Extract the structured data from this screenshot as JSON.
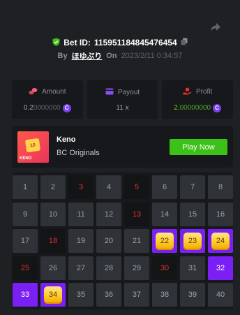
{
  "bet": {
    "id_label": "Bet ID:",
    "id_value": "115951184845476454",
    "by_label": "By",
    "user": "ほゆぷり",
    "on_label": "On",
    "timestamp": "2023/2/11 0:34:57"
  },
  "stats": {
    "amount": {
      "label": "Amount",
      "value_main": "0.2",
      "value_fade": "0000000",
      "coin": "C"
    },
    "payout": {
      "label": "Payout",
      "value": "11 x"
    },
    "profit": {
      "label": "Profit",
      "value_main": "2.",
      "value_fade": "00000000",
      "coin": "C"
    }
  },
  "game": {
    "name": "Keno",
    "provider": "BC Originals",
    "play_label": "Play Now",
    "thumb_number": "10",
    "thumb_tag": "KENO"
  },
  "board": {
    "cells": [
      {
        "n": "1",
        "s": "n"
      },
      {
        "n": "2",
        "s": "n"
      },
      {
        "n": "3",
        "s": "h"
      },
      {
        "n": "4",
        "s": "n"
      },
      {
        "n": "5",
        "s": "h"
      },
      {
        "n": "6",
        "s": "n"
      },
      {
        "n": "7",
        "s": "n"
      },
      {
        "n": "8",
        "s": "n"
      },
      {
        "n": "9",
        "s": "n"
      },
      {
        "n": "10",
        "s": "n"
      },
      {
        "n": "11",
        "s": "n"
      },
      {
        "n": "12",
        "s": "n"
      },
      {
        "n": "13",
        "s": "h"
      },
      {
        "n": "14",
        "s": "n"
      },
      {
        "n": "15",
        "s": "n"
      },
      {
        "n": "16",
        "s": "n"
      },
      {
        "n": "17",
        "s": "n"
      },
      {
        "n": "18",
        "s": "h"
      },
      {
        "n": "19",
        "s": "n"
      },
      {
        "n": "20",
        "s": "n"
      },
      {
        "n": "21",
        "s": "n"
      },
      {
        "n": "22",
        "s": "w"
      },
      {
        "n": "23",
        "s": "w"
      },
      {
        "n": "24",
        "s": "w"
      },
      {
        "n": "25",
        "s": "h"
      },
      {
        "n": "26",
        "s": "n"
      },
      {
        "n": "27",
        "s": "n"
      },
      {
        "n": "28",
        "s": "n"
      },
      {
        "n": "29",
        "s": "n"
      },
      {
        "n": "30",
        "s": "h"
      },
      {
        "n": "31",
        "s": "n"
      },
      {
        "n": "32",
        "s": "p"
      },
      {
        "n": "33",
        "s": "p"
      },
      {
        "n": "34",
        "s": "w"
      },
      {
        "n": "35",
        "s": "n"
      },
      {
        "n": "36",
        "s": "n"
      },
      {
        "n": "37",
        "s": "n"
      },
      {
        "n": "38",
        "s": "n"
      },
      {
        "n": "39",
        "s": "n"
      },
      {
        "n": "40",
        "s": "n"
      }
    ]
  },
  "icons": {
    "share": "share-icon",
    "verified": "shield-check-icon",
    "copy": "copy-icon",
    "amount": "coins-icon",
    "payout": "wallet-icon",
    "profit": "hand-coin-icon"
  },
  "colors": {
    "background": "#1e2024",
    "panel": "#17181b",
    "cell": "#2f3237",
    "selected": "#7b20f5",
    "hit_text": "#e1332e",
    "play_button": "#3bc117",
    "profit": "#5fd324"
  }
}
